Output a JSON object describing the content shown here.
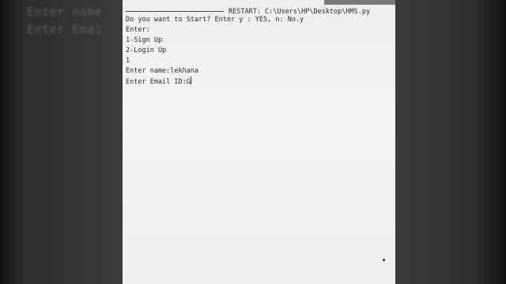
{
  "background": {
    "ghost_lines": [
      "Enter name",
      "Enter Emai"
    ]
  },
  "shell": {
    "restart_label": "RESTART: C:\\Users\\HP\\Desktop\\HMS.py",
    "lines": [
      "Do you want to Start? Enter y : YES, n: No.y",
      "Enter:",
      "1-Sign Up",
      "2-Login Up",
      "1",
      "Enter name:lekhana"
    ],
    "email_prompt": "Enter Email ID:",
    "email_value": "G"
  }
}
